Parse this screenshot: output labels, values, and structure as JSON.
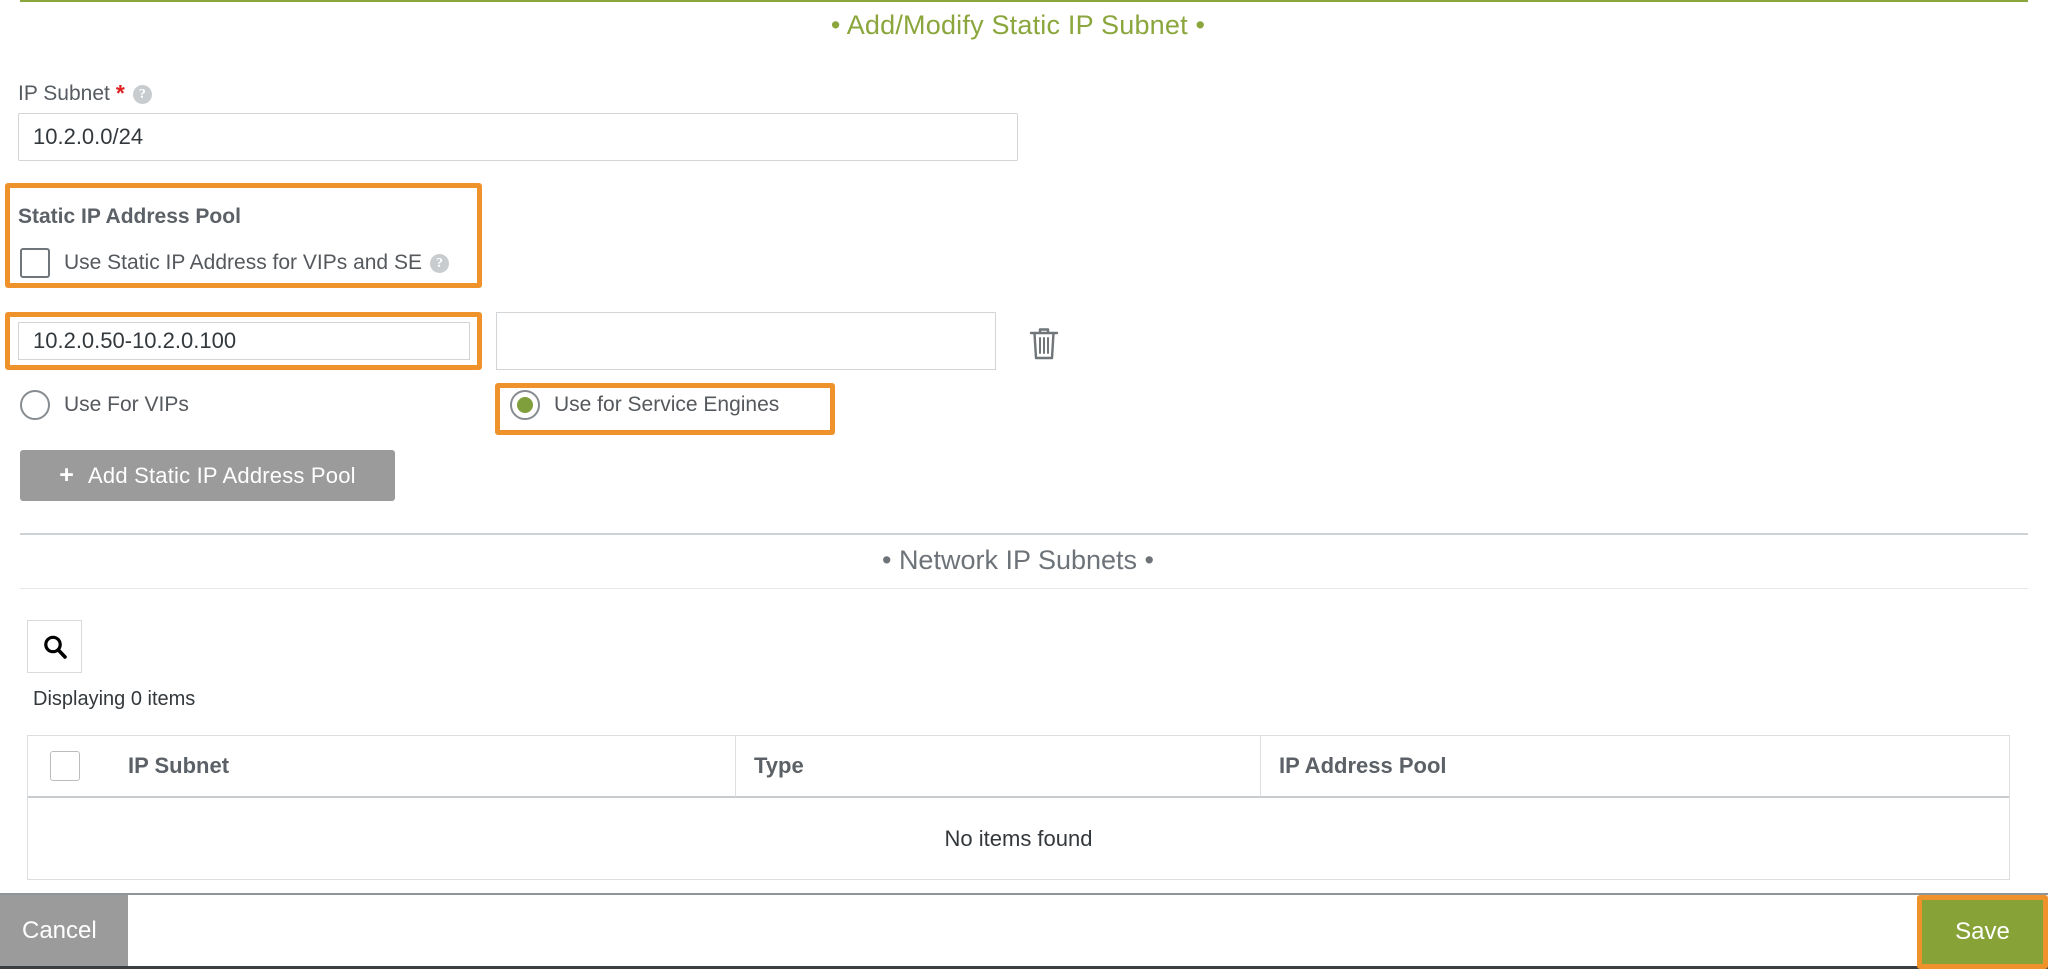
{
  "dialog": {
    "title": "• Add/Modify Static IP Subnet •"
  },
  "ip_subnet_field": {
    "label": "IP Subnet",
    "required_marker": "*",
    "help_icon": "help-circle-icon",
    "value": "10.2.0.0/24",
    "placeholder": ""
  },
  "static_pool": {
    "heading": "Static IP Address Pool",
    "checkbox_label": "Use Static IP Address for VIPs and SE",
    "checkbox_checked": false,
    "help_icon": "help-circle-icon",
    "range_value": "10.2.0.50-10.2.0.100",
    "range_placeholder": "",
    "second_value": "",
    "second_placeholder": "",
    "delete_icon": "trash-icon",
    "radios": [
      {
        "label": "Use For VIPs",
        "selected": false
      },
      {
        "label": "Use for Service Engines",
        "selected": true
      }
    ],
    "add_button_label": "Add Static IP Address Pool",
    "add_button_icon": "plus-icon"
  },
  "network_subnets": {
    "title": "• Network IP Subnets •",
    "search_icon": "search-icon",
    "displaying_text": "Displaying 0 items",
    "columns": [
      "IP Subnet",
      "Type",
      "IP Address Pool"
    ],
    "rows": [],
    "empty_text": "No items found"
  },
  "footer": {
    "cancel_label": "Cancel",
    "save_label": "Save"
  },
  "colors": {
    "accent_green": "#8aa63c",
    "save_green": "#87a338",
    "highlight_orange": "#f0922b",
    "required_red": "#e02020",
    "button_gray": "#9b9b9b"
  }
}
